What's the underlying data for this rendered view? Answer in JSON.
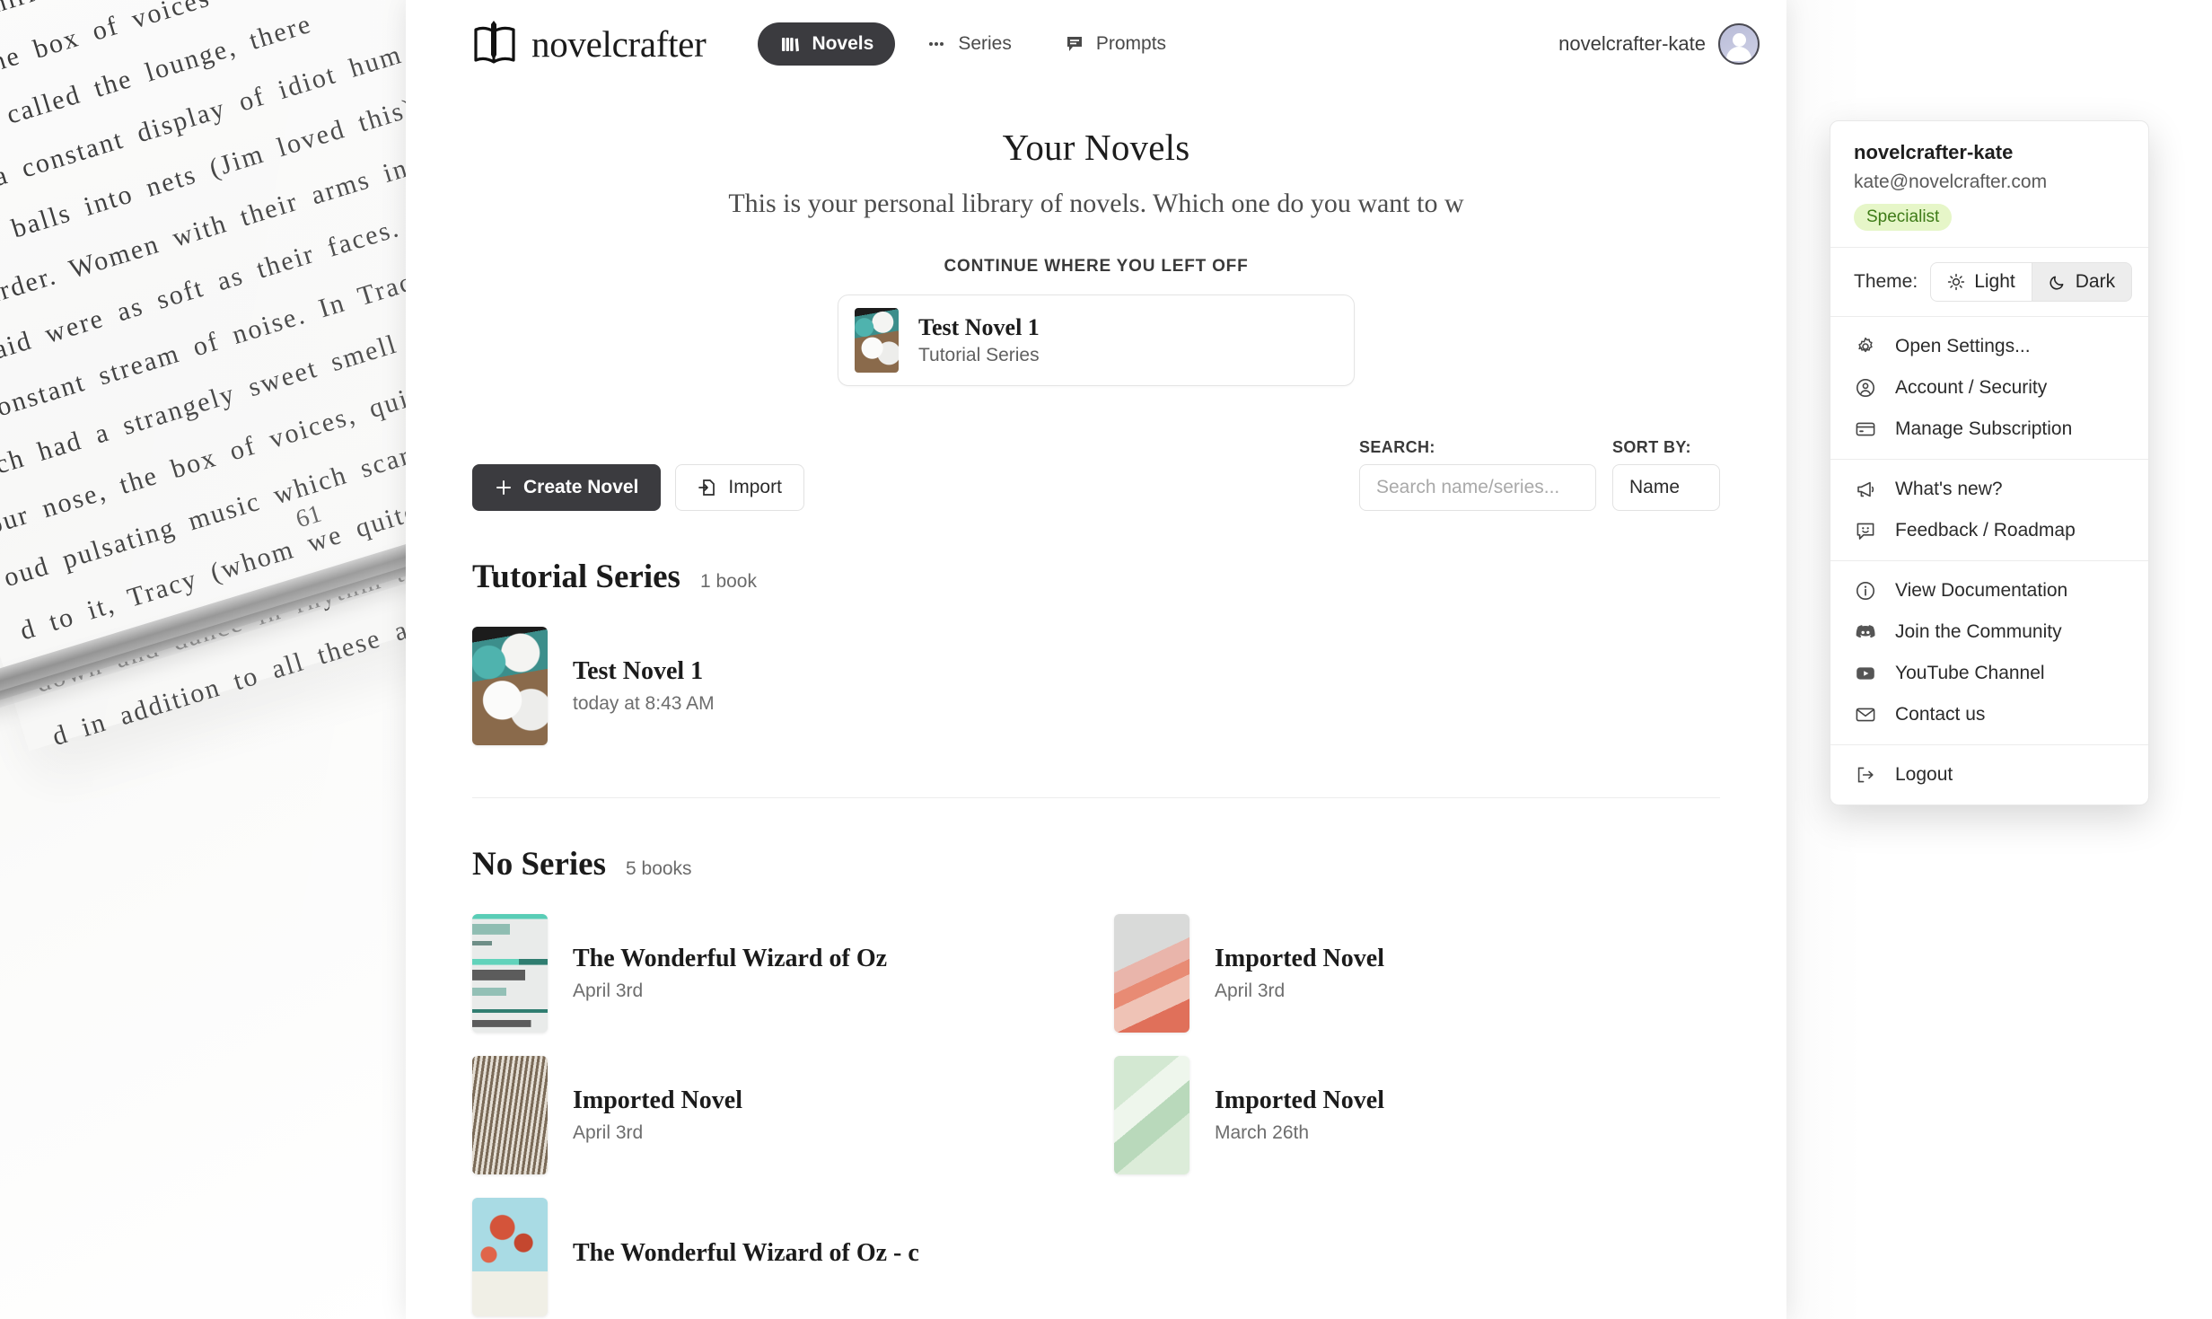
{
  "background": {
    "book_page_text": "d there w\nnot going on.   W\nhed on a whirring ele\ny played the box of voices\noom they called the lounge, there\nhowing a constant display of idiot hum\nkicking balls into nets (Jim loved this). N\nof murder. Women with their arms in\ney said were as soft as their faces. An\na constant stream of noise. In Tracy's b\nhich had a strangely sweet smell that\nour nose, the box of voices, quite a\noud pulsating music which scared us sill\nd to it, Tracy (whom we quite liked) w\ndown and dance in rhythm to the horril\nd in addition to all these artificial no",
    "page_number": "61"
  },
  "header": {
    "brand_name": "novelcrafter",
    "brand_icon": "open-book-pen-icon",
    "nav": [
      {
        "label": "Novels",
        "icon": "books-icon",
        "active": true
      },
      {
        "label": "Series",
        "icon": "ellipsis-icon",
        "active": false
      },
      {
        "label": "Prompts",
        "icon": "chat-bubble-icon",
        "active": false
      }
    ],
    "user_name": "novelcrafter-kate",
    "avatar_icon": "user-avatar-icon"
  },
  "hero": {
    "title": "Your Novels",
    "subtitle": "This is your personal library of novels. Which one do you want to w",
    "kicker": "CONTINUE WHERE YOU LEFT OFF",
    "continue_card": {
      "title": "Test Novel 1",
      "series": "Tutorial Series",
      "cover": "cov-dice"
    }
  },
  "toolbar": {
    "create_label": "Create Novel",
    "create_icon": "plus-icon",
    "import_label": "Import",
    "import_icon": "file-import-icon",
    "search_label": "SEARCH:",
    "search_placeholder": "Search name/series...",
    "search_value": "",
    "sort_label": "SORT BY:",
    "sort_value": "Name"
  },
  "sections": [
    {
      "title": "Tutorial Series",
      "count": "1 book",
      "books": [
        {
          "title": "Test Novel 1",
          "date": "today at 8:43 AM",
          "cover": "cov-dice"
        }
      ]
    },
    {
      "title": "No Series",
      "count": "5 books",
      "books": [
        {
          "title": "The Wonderful Wizard of Oz",
          "date": "April 3rd",
          "cover": "cov-oz"
        },
        {
          "title": "Imported Novel",
          "date": "April 3rd",
          "cover": "cov-rose"
        },
        {
          "title": "Imported Novel",
          "date": "April 3rd",
          "cover": "cov-wood"
        },
        {
          "title": "Imported Novel",
          "date": "March 26th",
          "cover": "cov-green"
        },
        {
          "title": "The Wonderful Wizard of Oz - c",
          "date": "",
          "cover": "cov-blossom"
        }
      ]
    }
  ],
  "user_menu": {
    "account_name": "novelcrafter-kate",
    "account_email": "kate@novelcrafter.com",
    "plan_badge": "Specialist",
    "plan_badge_bg": "#e6f6c8",
    "plan_badge_fg": "#3e7b17",
    "theme_label": "Theme:",
    "theme_light": "Light",
    "theme_light_icon": "sun-icon",
    "theme_dark": "Dark",
    "theme_dark_icon": "moon-icon",
    "theme_selected": "Dark",
    "groups": [
      [
        {
          "label": "Open Settings...",
          "icon": "gear-icon"
        },
        {
          "label": "Account / Security",
          "icon": "user-circle-icon"
        },
        {
          "label": "Manage Subscription",
          "icon": "credit-card-icon"
        }
      ],
      [
        {
          "label": "What's new?",
          "icon": "megaphone-icon"
        },
        {
          "label": "Feedback / Roadmap",
          "icon": "smiley-chat-icon"
        }
      ],
      [
        {
          "label": "View Documentation",
          "icon": "info-circle-icon"
        },
        {
          "label": "Join the Community",
          "icon": "discord-icon"
        },
        {
          "label": "YouTube Channel",
          "icon": "youtube-icon"
        },
        {
          "label": "Contact us",
          "icon": "envelope-icon"
        }
      ],
      [
        {
          "label": "Logout",
          "icon": "logout-icon"
        }
      ]
    ]
  }
}
